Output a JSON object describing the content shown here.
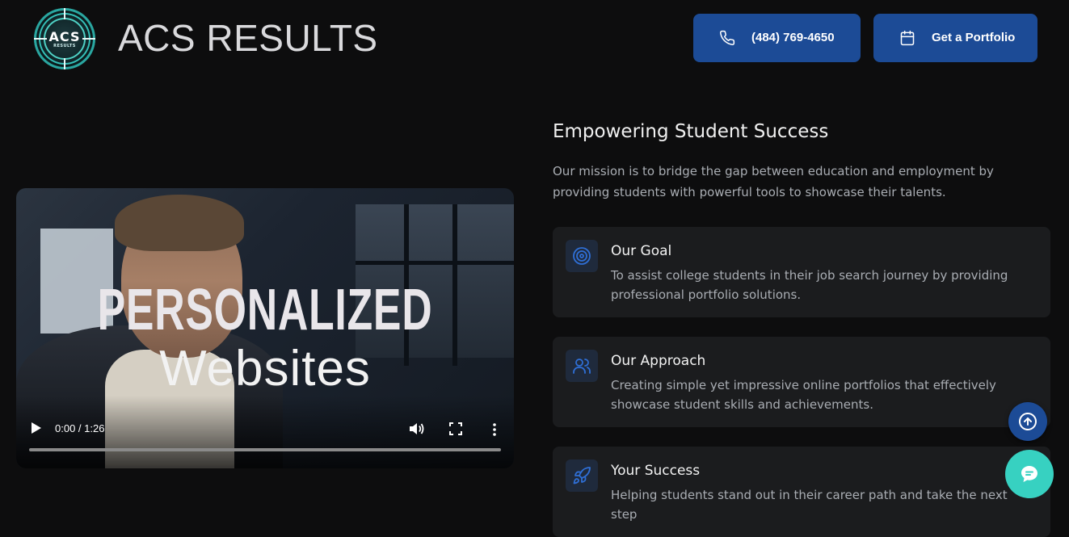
{
  "header": {
    "logo_text": "ACS",
    "logo_subtext": "RESULTS",
    "brand": "ACS RESULTS",
    "phone_label": "(484) 769-4650",
    "portfolio_label": "Get a Portfolio"
  },
  "video": {
    "title_line1": "PERSONALIZED",
    "title_line2": "Websites",
    "time": "0:00 / 1:26"
  },
  "section": {
    "heading": "Empowering Student Success",
    "mission": "Our mission is to bridge the gap between education and employment by providing students with powerful tools to showcase their talents."
  },
  "cards": [
    {
      "title": "Our Goal",
      "desc": "To assist college students in their job search journey by providing professional portfolio solutions.",
      "icon": "target-icon"
    },
    {
      "title": "Our Approach",
      "desc": "Creating simple yet impressive online portfolios that effectively showcase student skills and achievements.",
      "icon": "users-icon"
    },
    {
      "title": "Your Success",
      "desc": "Helping students stand out in their career path and take the next step",
      "icon": "rocket-icon"
    }
  ],
  "colors": {
    "background": "#0d0d0e",
    "button": "#1c4b96",
    "card": "#1b1c1e",
    "chat": "#37d1c1"
  }
}
